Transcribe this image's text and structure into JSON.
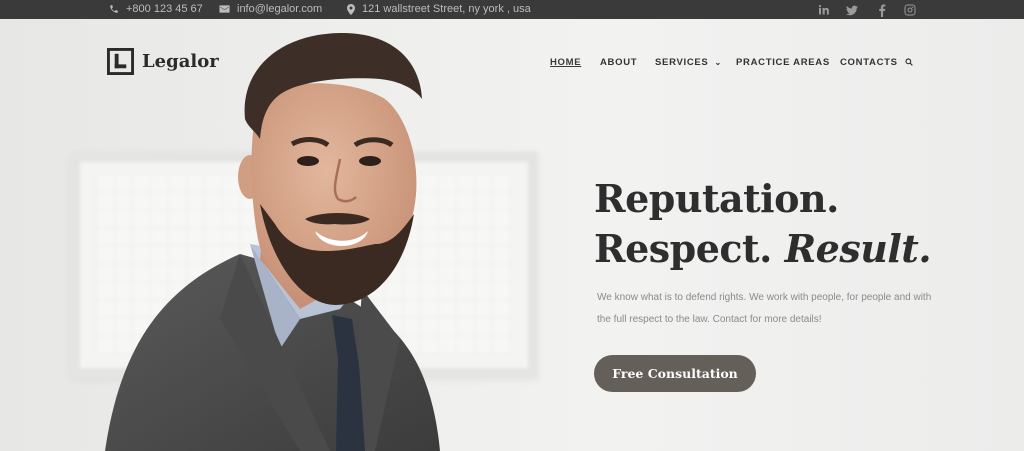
{
  "topbar": {
    "phone": "+800 123 45 67",
    "email": "info@legalor.com",
    "address": "121 wallstreet Street, ny york , usa",
    "phone_icon": "phone-icon",
    "email_icon": "envelope-icon",
    "address_icon": "map-pin-icon",
    "social": [
      "linkedin-icon",
      "twitter-icon",
      "facebook-icon",
      "instagram-icon"
    ]
  },
  "brand": {
    "name": "Legalor",
    "mark_letter": "L"
  },
  "nav": {
    "items": [
      "HOME",
      "ABOUT",
      "SERVICES",
      "PRACTICE AREAS",
      "CONTACTS"
    ],
    "active": "HOME",
    "search_icon": "search-icon"
  },
  "hero": {
    "line1": "Reputation.",
    "line2_plain": "Respect.",
    "line2_italic": "Result.",
    "description": "We know what is to defend rights. We work with people, for people and with the full respect to the law. Contact for more details!",
    "cta": "Free Consultation"
  },
  "colors": {
    "topbar_bg": "#3a3a3a",
    "cta_bg": "#655f59",
    "heading": "#2e2e2e",
    "text_muted": "#8a8a8a"
  }
}
